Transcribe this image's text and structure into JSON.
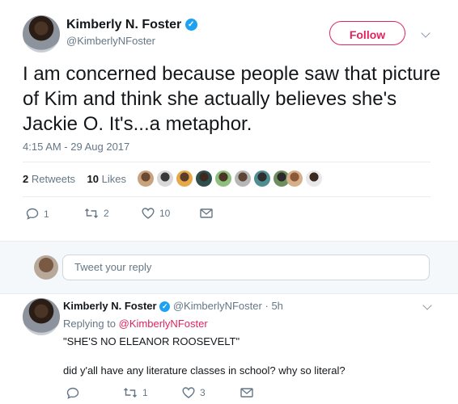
{
  "tweet": {
    "author_name": "Kimberly N. Foster",
    "author_handle": "@KimberlyNFoster",
    "follow_label": "Follow",
    "text": "I am concerned because people saw that picture of Kim and think she actually believes she's Jackie O. It's...a metaphor.",
    "timestamp": "4:15 AM - 29 Aug 2017",
    "retweets_count": "2",
    "retweets_label": "Retweets",
    "likes_count": "10",
    "likes_label": "Likes",
    "actions": {
      "reply_count": "1",
      "retweet_count": "2",
      "like_count": "10"
    }
  },
  "reply_box": {
    "placeholder": "Tweet your reply"
  },
  "reply": {
    "author_name": "Kimberly N. Foster",
    "author_handle": "@KimberlyNFoster",
    "age": "5h",
    "separator": "·",
    "replying_prefix": "Replying to",
    "replying_to": "@KimberlyNFoster",
    "line1": "\"SHE'S NO ELEANOR ROOSEVELT\"",
    "line2": "did y'all have any literature classes in school? why so literal?",
    "actions": {
      "retweet_count": "1",
      "like_count": "3"
    }
  },
  "colors": {
    "accent": "#e0245e",
    "verified": "#1da1f2",
    "muted": "#657786"
  },
  "icons": [
    "verified-icon",
    "chevron-down-icon",
    "reply-icon",
    "retweet-icon",
    "heart-icon",
    "mail-icon"
  ]
}
